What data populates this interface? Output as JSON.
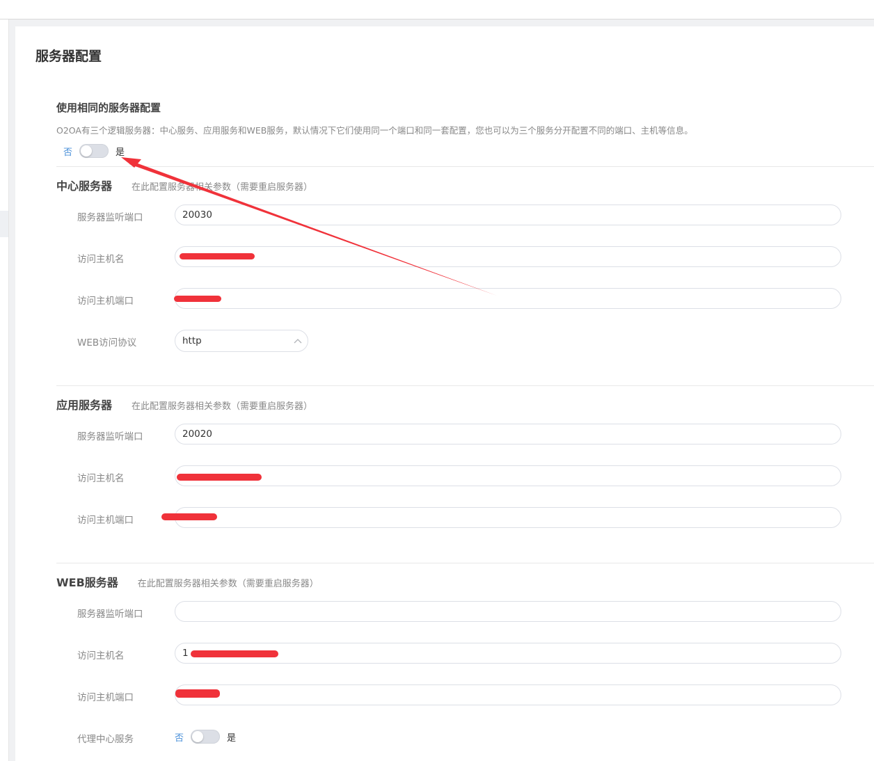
{
  "page": {
    "title": "服务器配置"
  },
  "same_config": {
    "title": "使用相同的服务器配置",
    "description": "O2OA有三个逻辑服务器：中心服务、应用服务和WEB服务，默认情况下它们使用同一个端口和同一套配置，您也可以为三个服务分开配置不同的端口、主机等信息。",
    "toggle": {
      "off_label": "否",
      "on_label": "是",
      "value": false
    }
  },
  "center_server": {
    "title": "中心服务器",
    "description": "在此配置服务器相关参数（需要重启服务器）",
    "listen_port_label": "服务器监听端口",
    "listen_port_value": "20030",
    "host_label": "访问主机名",
    "host_value": "",
    "port_label": "访问主机端口",
    "port_value": "",
    "protocol_label": "WEB访问协议",
    "protocol_value": "http"
  },
  "app_server": {
    "title": "应用服务器",
    "description": "在此配置服务器相关参数（需要重启服务器）",
    "listen_port_label": "服务器监听端口",
    "listen_port_value": "20020",
    "host_label": "访问主机名",
    "host_value": "",
    "port_label": "访问主机端口",
    "port_value": ""
  },
  "web_server": {
    "title": "WEB服务器",
    "description": "在此配置服务器相关参数（需要重启服务器）",
    "listen_port_label": "服务器监听端口",
    "listen_port_value": "",
    "host_label": "访问主机名",
    "host_value": "1",
    "port_label": "访问主机端口",
    "port_value": "",
    "proxy_label": "代理中心服务",
    "proxy_toggle": {
      "off_label": "否",
      "on_label": "是",
      "value": false
    }
  },
  "colors": {
    "accent": "#4a90d9",
    "annotation": "#f0323a"
  }
}
